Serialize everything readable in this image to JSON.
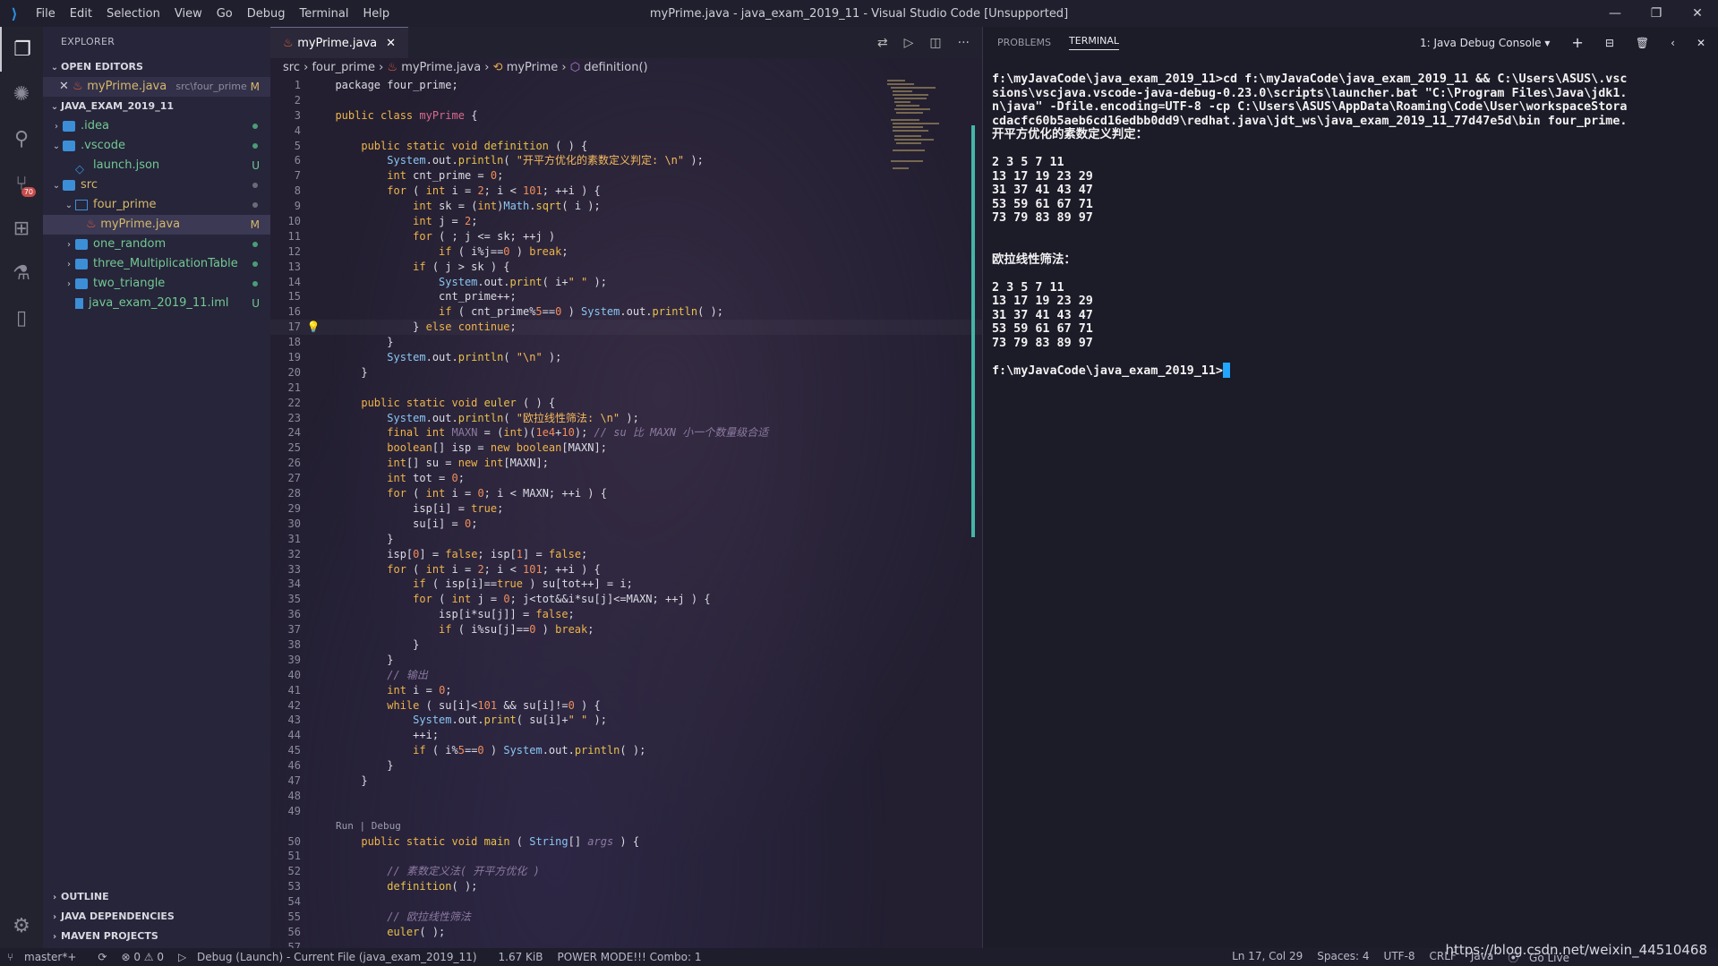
{
  "window": {
    "title": "myPrime.java - java_exam_2019_11 - Visual Studio Code [Unsupported]",
    "menu": [
      "File",
      "Edit",
      "Selection",
      "View",
      "Go",
      "Debug",
      "Terminal",
      "Help"
    ]
  },
  "activity": {
    "scm_badge": "70"
  },
  "sidebar": {
    "header": "EXPLORER",
    "open_editors_label": "OPEN EDITORS",
    "open_editor": {
      "name": "myPrime.java",
      "path": "src\\four_prime",
      "status": "M"
    },
    "workspace_label": "JAVA_EXAM_2019_11",
    "tree": [
      {
        "name": ".idea",
        "status": ""
      },
      {
        "name": ".vscode",
        "status": ""
      },
      {
        "name": "launch.json",
        "status": "U"
      },
      {
        "name": "src",
        "status": ""
      },
      {
        "name": "four_prime",
        "status": ""
      },
      {
        "name": "myPrime.java",
        "status": "M"
      },
      {
        "name": "one_random",
        "status": ""
      },
      {
        "name": "three_MultiplicationTable",
        "status": ""
      },
      {
        "name": "two_triangle",
        "status": ""
      },
      {
        "name": "java_exam_2019_11.iml",
        "status": "U"
      }
    ],
    "bottom_sections": [
      "OUTLINE",
      "JAVA DEPENDENCIES",
      "MAVEN PROJECTS"
    ]
  },
  "editor": {
    "tab": "myPrime.java",
    "breadcrumbs": [
      "src",
      "four_prime",
      "myPrime.java",
      "myPrime",
      "definition()"
    ],
    "codelens": "Run | Debug"
  },
  "panel": {
    "tabs": [
      "PROBLEMS",
      "TERMINAL"
    ],
    "console_select": "1: Java Debug Console",
    "terminal_lines": [
      "f:\\myJavaCode\\java_exam_2019_11>cd f:\\myJavaCode\\java_exam_2019_11 && C:\\Users\\ASUS\\.vsc",
      "sions\\vscjava.vscode-java-debug-0.23.0\\scripts\\launcher.bat \"C:\\Program Files\\Java\\jdk1.",
      "n\\java\" -Dfile.encoding=UTF-8 -cp C:\\Users\\ASUS\\AppData\\Roaming\\Code\\User\\workspaceStora",
      "cdacfc60b5aeb6cd16edbb0dd9\\redhat.java\\jdt_ws\\java_exam_2019_11_77d47e5d\\bin four_prime.",
      "开平方优化的素数定义判定：",
      "",
      "2 3 5 7 11",
      "13 17 19 23 29",
      "31 37 41 43 47",
      "53 59 61 67 71",
      "73 79 83 89 97",
      "",
      "",
      "欧拉线性筛法：",
      "",
      "2 3 5 7 11",
      "13 17 19 23 29",
      "31 37 41 43 47",
      "53 59 61 67 71",
      "73 79 83 89 97",
      "",
      "f:\\myJavaCode\\java_exam_2019_11>"
    ]
  },
  "status": {
    "branch": "master*+",
    "problems": "⊗ 0 ⚠ 0",
    "debug": "Debug (Launch) - Current File (java_exam_2019_11)",
    "size": "1.67 KiB",
    "power": "POWER MODE!!! Combo: 1",
    "position": "Ln 17, Col 29",
    "spaces": "Spaces: 4",
    "encoding": "UTF-8",
    "eol": "CRLF",
    "language": "Java",
    "golive": "Go Live"
  },
  "watermark": "https://blog.csdn.net/weixin_44510468"
}
